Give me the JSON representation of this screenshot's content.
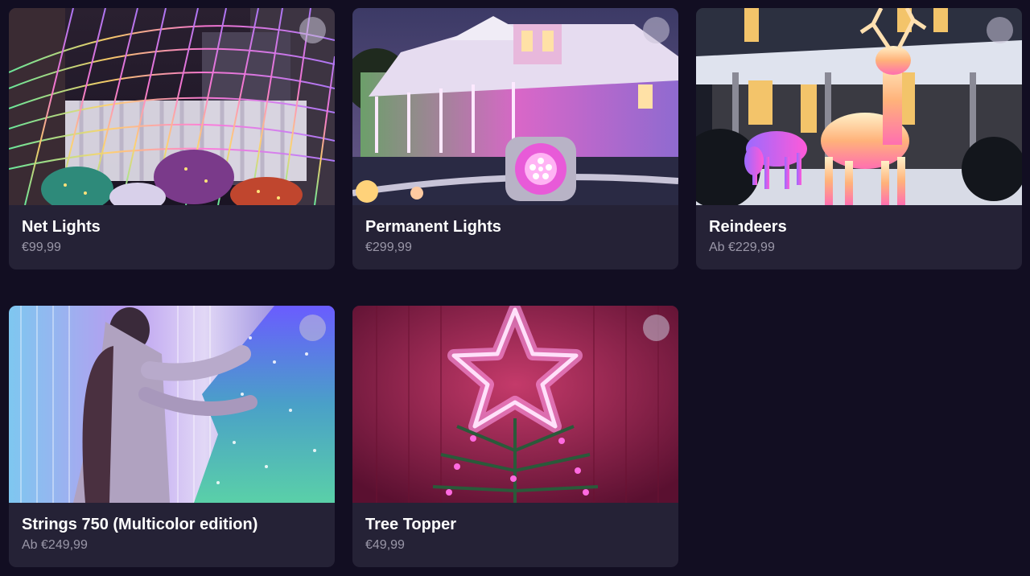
{
  "products": [
    {
      "id": "net",
      "title": "Net Lights",
      "price": "€99,99",
      "image_icon": "net-lights-house-image"
    },
    {
      "id": "permanent",
      "title": "Permanent Lights",
      "price": "€299,99",
      "image_icon": "permanent-lights-house-image"
    },
    {
      "id": "reindeers",
      "title": "Reindeers",
      "price": "Ab €229,99",
      "image_icon": "reindeer-lights-image"
    },
    {
      "id": "strings",
      "title": "Strings 750 (Multicolor edition)",
      "price": "Ab €249,99",
      "image_icon": "strings-tree-image"
    },
    {
      "id": "topper",
      "title": "Tree Topper",
      "price": "€49,99",
      "image_icon": "star-tree-topper-image"
    }
  ],
  "colors": {
    "background": "#120e22",
    "card": "#252236",
    "title": "#ffffff",
    "price": "#9a97a8"
  }
}
